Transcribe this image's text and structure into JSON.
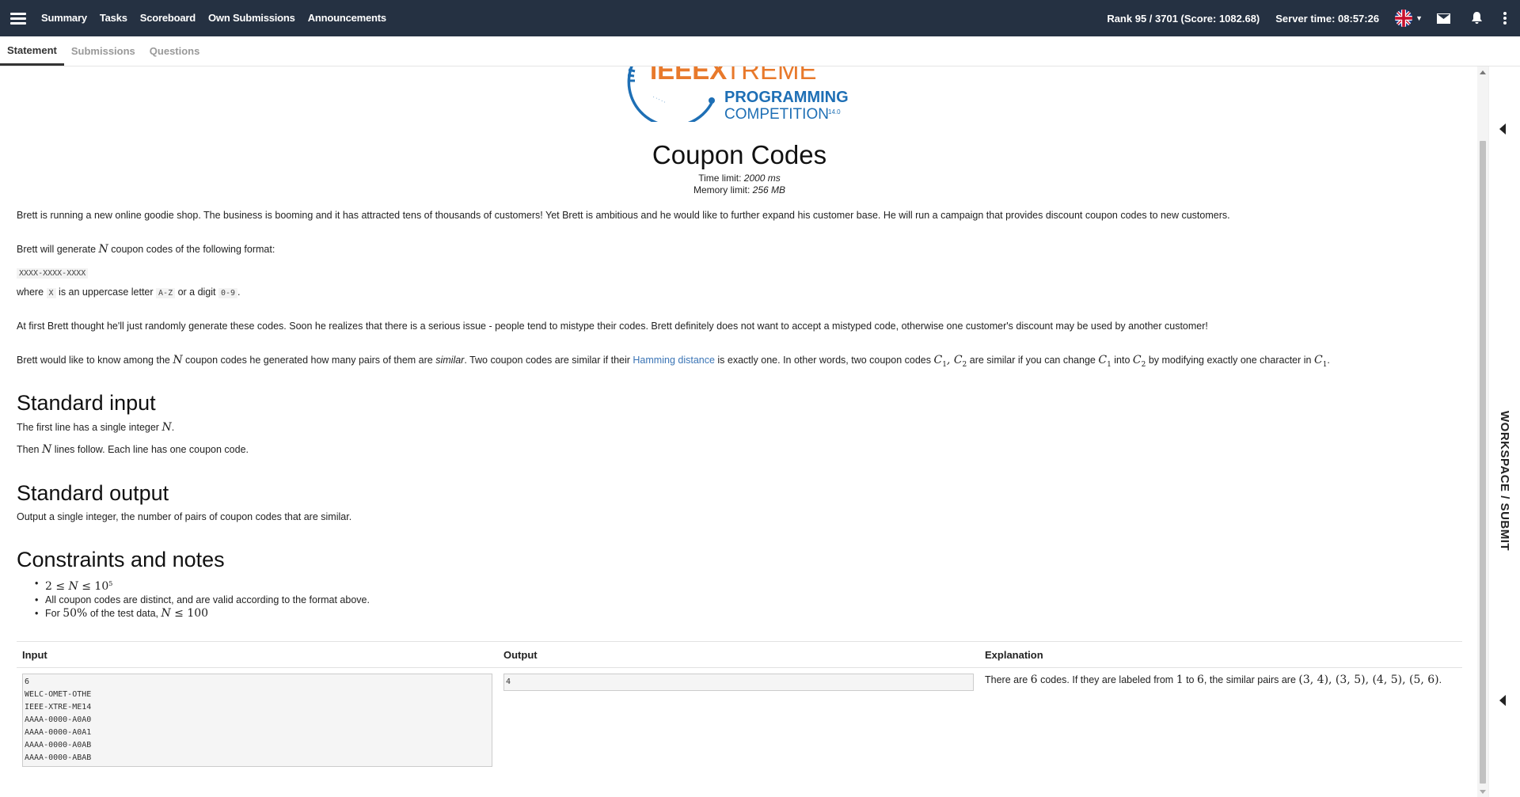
{
  "topbar": {
    "nav": [
      "Summary",
      "Tasks",
      "Scoreboard",
      "Own Submissions",
      "Announcements"
    ],
    "rank": "Rank 95 / 3701 (Score: 1082.68)",
    "server_time": "Server time: 08:57:26"
  },
  "subtabs": [
    "Statement",
    "Submissions",
    "Questions"
  ],
  "side_panel_label": "WORKSPACE / SUBMIT",
  "logo": {
    "line1a": "IEEEX",
    "line1b": "TREME",
    "line2": "PROGRAMMING",
    "line3": "COMPETITION",
    "version": "14.0"
  },
  "problem": {
    "title": "Coupon Codes",
    "time_limit_label": "Time limit:",
    "time_limit": "2000 ms",
    "memory_limit_label": "Memory limit:",
    "memory_limit": "256 MB",
    "intro": "Brett is running a new online goodie shop. The business is booming and it has attracted tens of thousands of customers! Yet Brett is ambitious and he would like to further expand his customer base. He will run a campaign that provides discount coupon codes to new customers.",
    "generate_pre": "Brett will generate ",
    "generate_post": " coupon codes of the following format:",
    "format": "XXXX-XXXX-XXXX",
    "where_pre": "where ",
    "where_x": "X",
    "where_mid": " is an uppercase letter ",
    "where_az": "A-Z",
    "where_or": " or a digit ",
    "where_09": "0-9",
    "where_end": ".",
    "issue": "At first Brett thought he'll just randomly generate these codes. Soon he realizes that there is a serious issue - people tend to mistype their codes. Brett definitely does not want to accept a mistyped code, otherwise one customer's discount may be used by another customer!",
    "similar_1": "Brett would like to know among the ",
    "similar_2": " coupon codes he generated how many pairs of them are ",
    "similar_word": "similar",
    "similar_3": ". Two coupon codes are similar if their ",
    "hamming": "Hamming distance",
    "similar_4": " is exactly one. In other words, two coupon codes ",
    "similar_5": " are similar if you can change ",
    "similar_6": " into ",
    "similar_7": " by modifying exactly one character in ",
    "similar_8": ".",
    "var_n": "N",
    "var_c1": "C",
    "var_c2": "C",
    "sub1": "1",
    "sub2": "2",
    "input_heading": "Standard input",
    "input_1_pre": "The first line has a single integer ",
    "input_1_post": ".",
    "input_2_pre": "Then ",
    "input_2_post": " lines follow. Each line has one coupon code.",
    "output_heading": "Standard output",
    "output_text": "Output a single integer, the number of pairs of coupon codes that are similar.",
    "constraints_heading": "Constraints and notes",
    "c1_a": "2 ≤ ",
    "c1_b": " ≤ 10",
    "c1_exp": "5",
    "c2": "All coupon codes are distinct, and are valid according to the format above.",
    "c3_a": "For ",
    "c3_pct": "50%",
    "c3_b": " of the test data, ",
    "c3_c": " ≤ 100"
  },
  "examples": {
    "headers": [
      "Input",
      "Output",
      "Explanation"
    ],
    "input": "6\nWELC-OMET-OTHE\nIEEE-XTRE-ME14\nAAAA-0000-A0A0\nAAAA-0000-A0A1\nAAAA-0000-A0AB\nAAAA-0000-ABAB",
    "output": "4",
    "expl_1": "There are ",
    "expl_6": "6",
    "expl_2": " codes. If they are labeled from ",
    "expl_from": "1",
    "expl_3": " to ",
    "expl_to": "6",
    "expl_4": ", the similar pairs are ",
    "expl_pairs": "(3, 4), (3, 5), (4, 5), (5, 6)",
    "expl_5": "."
  },
  "colors": {
    "topbar": "#253142",
    "logo_orange": "#e8792b",
    "logo_blue": "#1e6fb5",
    "link": "#3a74b5"
  },
  "icons": [
    "menu-icon",
    "uk-flag-icon",
    "mail-icon",
    "bell-icon",
    "more-vertical-icon"
  ]
}
